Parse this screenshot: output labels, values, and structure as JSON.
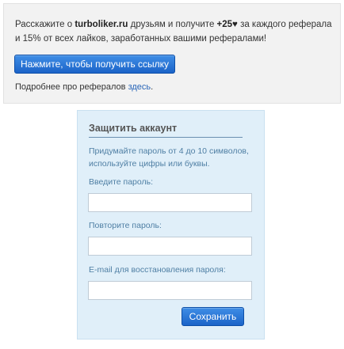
{
  "referral": {
    "intro_part1": "Расскажите о ",
    "site_name": "turboliker.ru",
    "intro_part2": " друзьям и получите ",
    "bonus": "+25♥",
    "intro_part3": " за каждого реферала и 15% от всех лайков, заработанных вашими рефералами!",
    "get_link_button": "Нажмите, чтобы получить ссылку",
    "more_prefix": "Подробнее про рефералов ",
    "more_link": "здесь",
    "more_suffix": "."
  },
  "protect": {
    "title": "Защитить аккаунт",
    "hint": "Придумайте пароль от 4 до 10 символов, используйте цифры или буквы.",
    "password_label": "Введите пароль:",
    "password_value": "",
    "repeat_label": "Повторите пароль:",
    "repeat_value": "",
    "email_label": "E-mail для восстановления пароля:",
    "email_value": "",
    "save_button": "Сохранить"
  },
  "colors": {
    "button_top": "#3f8ee6",
    "button_bottom": "#1b63c8",
    "card_background": "#e0eff9",
    "hint_text": "#4f7fa4",
    "link": "#2a66b8"
  }
}
